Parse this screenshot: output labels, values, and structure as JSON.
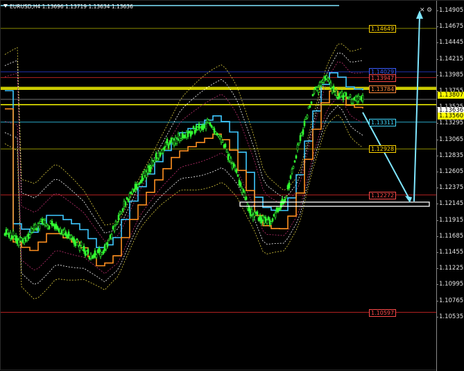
{
  "header": {
    "symbol_line": "EURUSD,H4  1.13696 1.13719 1.13634 1.13636"
  },
  "price_axis": {
    "ticks": [
      "1.14905",
      "1.14675",
      "1.14445",
      "1.14215",
      "1.13985",
      "1.13755",
      "1.13525",
      "1.13295",
      "1.13065",
      "1.12835",
      "1.12605",
      "1.12375",
      "1.12145",
      "1.11915",
      "1.11685",
      "1.11455",
      "1.11225",
      "1.10995",
      "1.10765",
      "1.10535"
    ],
    "badges": {
      "high": "1.13807",
      "bid": "1.13636",
      "low": "1.13560"
    }
  },
  "levels": [
    {
      "label": "1.14649",
      "price": 1.14649,
      "color": "#ffd400",
      "line": "#8a8a00"
    },
    {
      "label": "1.14029",
      "price": 1.14029,
      "color": "#3a5cff",
      "line": "#1f2fa8"
    },
    {
      "label": "1.13947",
      "price": 1.13947,
      "color": "#ff4a4a",
      "line": "#b02020"
    },
    {
      "label": "1.13784",
      "price": 1.13784,
      "color": "#ff8a3a",
      "line": "#ffff00"
    },
    {
      "label": "1.13311",
      "price": 1.13311,
      "color": "#40d8ff",
      "line": "#2aa8c8"
    },
    {
      "label": "1.12928",
      "price": 1.12928,
      "color": "#ffd400",
      "line": "#8a8a00"
    },
    {
      "label": "1.12272",
      "price": 1.12272,
      "color": "#ff4a4a",
      "line": "#b02020"
    },
    {
      "label": "1.10597",
      "price": 1.10597,
      "color": "#ff4a4a",
      "line": "#b02020"
    }
  ],
  "colors": {
    "background": "#000000",
    "candle": "#33ff33",
    "band_cyan": "#3fc8ff",
    "band_orange": "#ff9020",
    "arrow": "#7fe6ff",
    "yellow_line": "#ffff00",
    "red_band": "#ff2a2a"
  },
  "icons": {
    "gear": "⚙",
    "close": "✕"
  }
}
